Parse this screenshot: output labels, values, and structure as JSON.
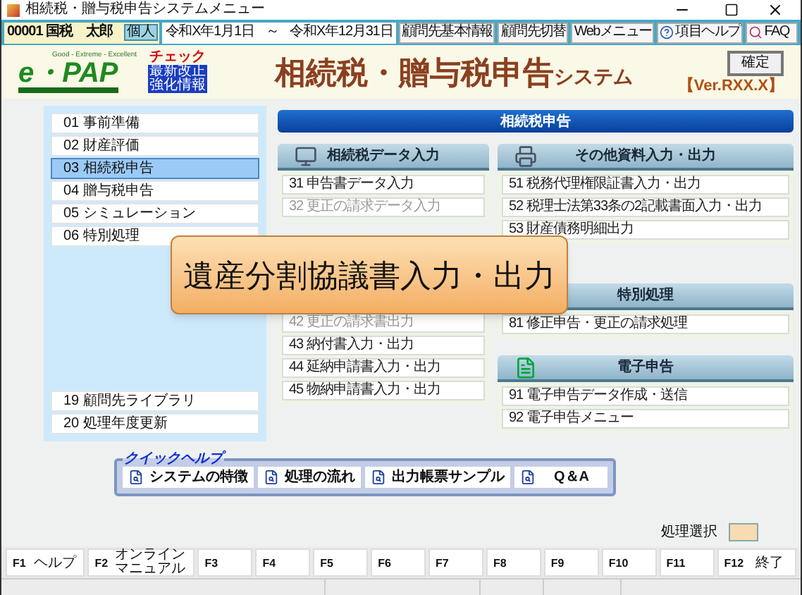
{
  "window": {
    "title": "相続税・贈与税申告システムメニュー"
  },
  "toolbar": {
    "client": "00001 国税　太郎",
    "client_type": "個人",
    "period_start": "令和X年1月1日",
    "period_separator": "～",
    "period_end": "令和X年12月31日",
    "buttons": [
      {
        "label": "顧問先基本情報",
        "kind": "text"
      },
      {
        "label": "顧問先切替",
        "kind": "text"
      },
      {
        "label": "Webメニュー",
        "kind": "text"
      },
      {
        "label": "項目ヘルプ",
        "kind": "help"
      },
      {
        "label": "FAQ",
        "kind": "faq"
      }
    ]
  },
  "header": {
    "logo": "e・PAP",
    "logo_tagline": "Good - Extreme - Excellent",
    "badge_top": "チェック",
    "badge_lines": [
      "最新改正",
      "強化情報"
    ],
    "title": "相続税・贈与税申告",
    "title_suffix": "システム",
    "confirm_button": "確定",
    "version": "【Ver.RXX.X】"
  },
  "menu": {
    "items": [
      {
        "label": "01 事前準備",
        "selected": false
      },
      {
        "label": "02 財産評価",
        "selected": false
      },
      {
        "label": "03 相続税申告",
        "selected": true
      },
      {
        "label": "04 贈与税申告",
        "selected": false
      },
      {
        "label": "05 シミュレーション",
        "selected": false
      },
      {
        "label": "06 特別処理",
        "selected": false
      }
    ],
    "bottom_items": [
      {
        "label": "19 顧問先ライブラリ",
        "selected": false
      },
      {
        "label": "20 処理年度更新",
        "selected": false
      }
    ]
  },
  "panel": {
    "title": "相続税申告",
    "left_sections": [
      {
        "title": "相続税データ入力",
        "items": [
          {
            "label": "31 申告書データ入力",
            "disabled": false
          },
          {
            "label": "32 更正の請求データ入力",
            "disabled": true
          }
        ]
      },
      {
        "items": [
          {
            "label": "42 更正の請求書出力",
            "disabled": true
          },
          {
            "label": "43 納付書入力・出力",
            "disabled": false
          },
          {
            "label": "44 延納申請書入力・出力",
            "disabled": false
          },
          {
            "label": "45 物納申請書入力・出力",
            "disabled": false
          }
        ]
      }
    ],
    "right_sections": [
      {
        "title": "その他資料入力・出力",
        "items": [
          {
            "label": "51 税務代理権限証書入力・出力",
            "disabled": false
          },
          {
            "label": "52 税理士法第33条の2記載書面入力・出力",
            "disabled": false
          },
          {
            "label": "53 財産債務明細出力",
            "disabled": false
          }
        ]
      },
      {
        "title": "特別処理",
        "items": [
          {
            "label": "81 修正申告・更正の請求処理",
            "disabled": false
          }
        ]
      },
      {
        "title": "電子申告",
        "items": [
          {
            "label": "91 電子申告データ作成・送信",
            "disabled": false
          },
          {
            "label": "92 電子申告メニュー",
            "disabled": false
          }
        ]
      }
    ]
  },
  "tooltip": {
    "text": "遺産分割協議書入力・出力"
  },
  "quick_help": {
    "title": "クイックヘルプ",
    "buttons": [
      "システムの特徴",
      "処理の流れ",
      "出力帳票サンプル",
      "Q＆A"
    ]
  },
  "process_select": {
    "label": "処理選択"
  },
  "function_keys": [
    {
      "key": "F1",
      "label": "ヘルプ"
    },
    {
      "key": "F2",
      "label": "オンラインマニュアル"
    },
    {
      "key": "F3"
    },
    {
      "key": "F4"
    },
    {
      "key": "F5"
    },
    {
      "key": "F6"
    },
    {
      "key": "F7"
    },
    {
      "key": "F8"
    },
    {
      "key": "F9"
    },
    {
      "key": "F10"
    },
    {
      "key": "F11"
    },
    {
      "key": "F12",
      "label": "終了"
    }
  ]
}
